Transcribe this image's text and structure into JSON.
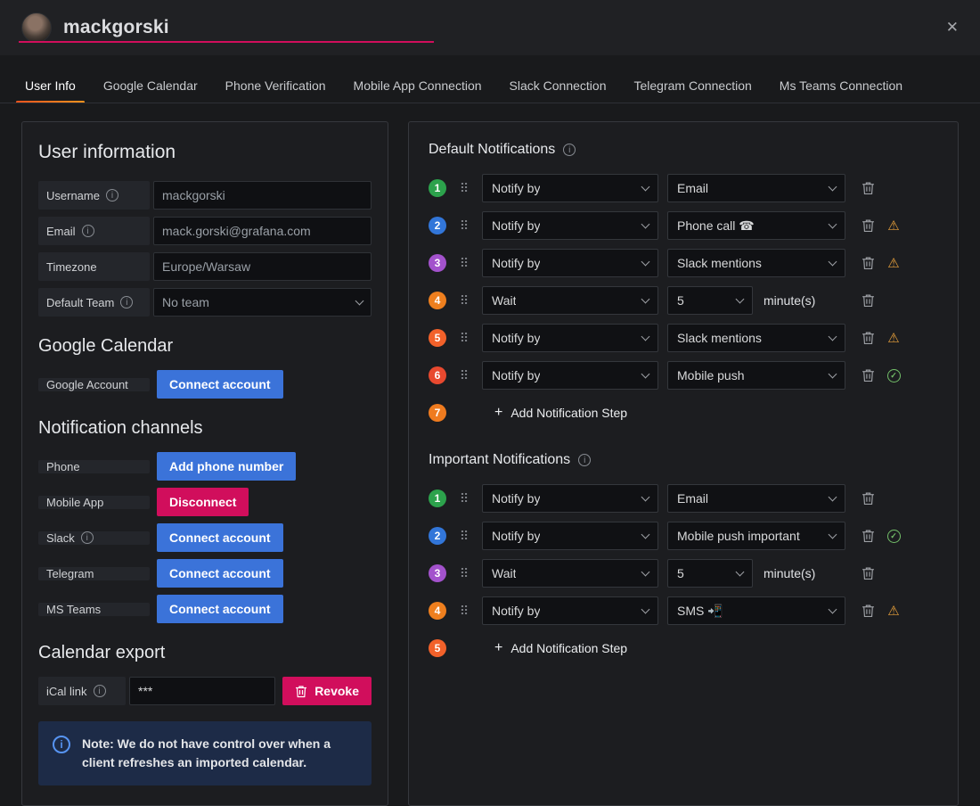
{
  "header": {
    "title": "mackgorski"
  },
  "icons": {
    "close": "✕",
    "info": "i",
    "warning": "⚠",
    "check": "✓",
    "drag": "⠿",
    "plus": "+"
  },
  "colors": {
    "primary_blue": "#3b73d9",
    "destructive_red": "#d10e5c",
    "tab_accent_orange": "#f2541d",
    "warning_orange": "#e9a13b",
    "success_green": "#73bf69",
    "badge_colors": [
      "#2ca24c",
      "#3276d9",
      "#a352cc",
      "#ee7f1e",
      "#f2612a",
      "#e8492f",
      "#ef7b1f"
    ]
  },
  "tabs": [
    "User Info",
    "Google Calendar",
    "Phone Verification",
    "Mobile App Connection",
    "Slack Connection",
    "Telegram Connection",
    "Ms Teams Connection"
  ],
  "left": {
    "heading_user": "User information",
    "fields": {
      "username": {
        "label": "Username",
        "value": "mackgorski"
      },
      "email": {
        "label": "Email",
        "value": "mack.gorski@grafana.com"
      },
      "timezone": {
        "label": "Timezone",
        "value": "Europe/Warsaw"
      },
      "team": {
        "label": "Default Team",
        "value": "No team"
      }
    },
    "heading_gcal": "Google Calendar",
    "google": {
      "label": "Google Account",
      "button": "Connect account"
    },
    "heading_channels": "Notification channels",
    "channels": {
      "phone": {
        "label": "Phone",
        "button": "Add phone number"
      },
      "mobile": {
        "label": "Mobile App",
        "button": "Disconnect"
      },
      "slack": {
        "label": "Slack",
        "button": "Connect account"
      },
      "telegram": {
        "label": "Telegram",
        "button": "Connect account"
      },
      "msteams": {
        "label": "MS Teams",
        "button": "Connect account"
      }
    },
    "heading_export": "Calendar export",
    "ical": {
      "label": "iCal link",
      "value": "***",
      "revoke": "Revoke"
    },
    "note": {
      "text": "Note: We do not have control over when a client refreshes an imported calendar."
    }
  },
  "right": {
    "default": {
      "heading": "Default Notifications",
      "rows": [
        {
          "num": "1",
          "type": "Notify by",
          "channel": "Email"
        },
        {
          "num": "2",
          "type": "Notify by",
          "channel": "Phone call ☎"
        },
        {
          "num": "3",
          "type": "Notify by",
          "channel": "Slack mentions"
        },
        {
          "num": "4",
          "type": "Wait",
          "value": "5",
          "suffix": "minute(s)"
        },
        {
          "num": "5",
          "type": "Notify by",
          "channel": "Slack mentions"
        },
        {
          "num": "6",
          "type": "Notify by",
          "channel": "Mobile push"
        },
        {
          "num": "7",
          "add": "Add Notification Step"
        }
      ]
    },
    "important": {
      "heading": "Important Notifications",
      "rows": [
        {
          "num": "1",
          "type": "Notify by",
          "channel": "Email"
        },
        {
          "num": "2",
          "type": "Notify by",
          "channel": "Mobile push important"
        },
        {
          "num": "3",
          "type": "Wait",
          "value": "5",
          "suffix": "minute(s)"
        },
        {
          "num": "4",
          "type": "Notify by",
          "channel": "SMS 📲"
        },
        {
          "num": "5",
          "add": "Add Notification Step"
        }
      ]
    }
  }
}
